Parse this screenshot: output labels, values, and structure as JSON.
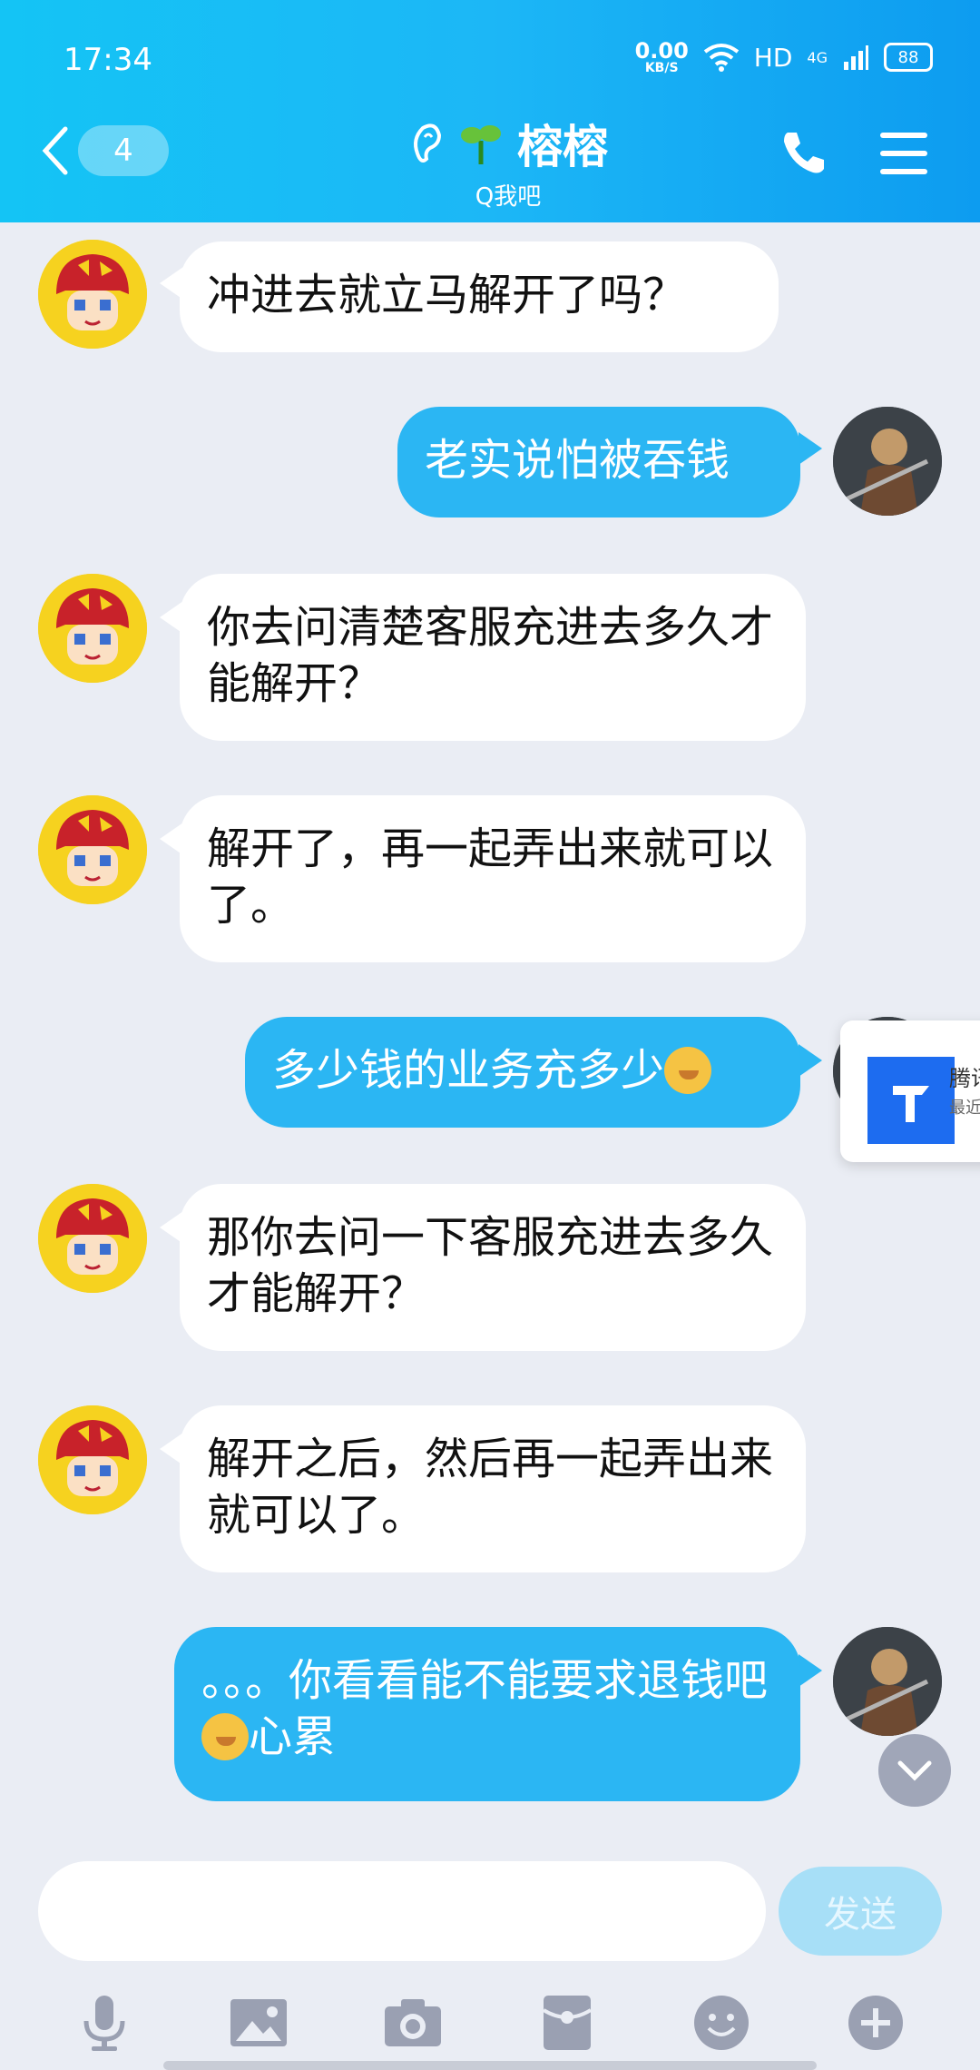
{
  "status_bar": {
    "time": "17:34",
    "net_speed_value": "0.00",
    "net_speed_unit": "KB/S",
    "hd_label": "HD",
    "network": "4G",
    "battery": "88"
  },
  "header": {
    "back_badge": "4",
    "contact_name": "榕榕",
    "contact_subtitle": "Q我吧"
  },
  "messages": [
    {
      "side": "left",
      "text": "冲进去就立马解开了吗？"
    },
    {
      "side": "right",
      "text": "老实说怕被吞钱"
    },
    {
      "side": "left",
      "text": "你去问清楚客服充进去多久才能解开？"
    },
    {
      "side": "left",
      "text": "解开了，再一起弄出来就可以了。"
    },
    {
      "side": "right",
      "text": "多少钱的业务充多少"
    },
    {
      "side": "left",
      "text": "那你去问一下客服充进去多久才能解开？"
    },
    {
      "side": "left",
      "text": "解开之后，然后再一起弄出来就可以了。"
    },
    {
      "side": "right",
      "text_a": "。。。你看看能不能要求退钱吧",
      "text_b": "心累"
    }
  ],
  "floating_card": {
    "line1": "腾讯",
    "line2": "最近"
  },
  "input": {
    "placeholder": "",
    "send_label": "发送"
  },
  "colors": {
    "header": "#1cb7f6",
    "bubble_self": "#2bb6f3",
    "background": "#eaedf4"
  }
}
